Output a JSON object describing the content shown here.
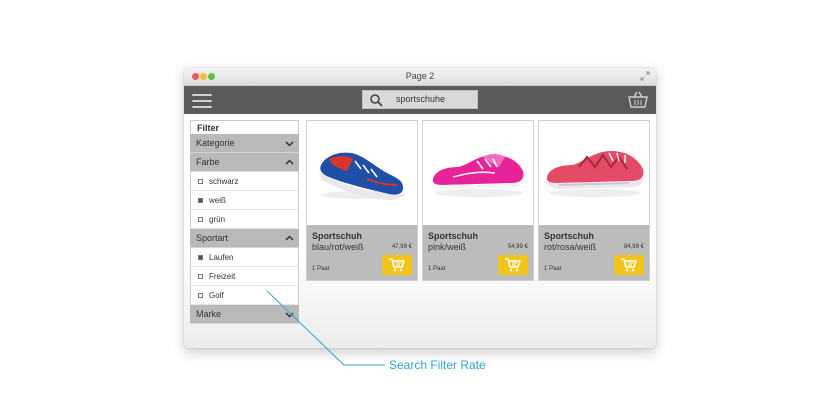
{
  "window": {
    "title": "Page 2"
  },
  "search": {
    "value": "sportschuhe"
  },
  "sidebar": {
    "heading": "Filter",
    "groups": [
      {
        "label": "Kategorie",
        "expanded": false,
        "options": []
      },
      {
        "label": "Farbe",
        "expanded": true,
        "options": [
          {
            "label": "schwarz",
            "checked": false
          },
          {
            "label": "weiß",
            "checked": true
          },
          {
            "label": "grün",
            "checked": false
          }
        ]
      },
      {
        "label": "Sportart",
        "expanded": true,
        "options": [
          {
            "label": "Laufen",
            "checked": true
          },
          {
            "label": "Freizeit",
            "checked": false
          },
          {
            "label": "Golf",
            "checked": false
          }
        ]
      },
      {
        "label": "Marke",
        "expanded": false,
        "options": []
      }
    ]
  },
  "products": [
    {
      "name": "Sportschuh",
      "color": "blau/rot/weiß",
      "price": "47,99 €",
      "qty": "1 Paar",
      "image": "shoe-blue-red",
      "shoe_colors": {
        "upper": "#1f4fa6",
        "accent": "#d8352f",
        "sole": "#e9e9e9"
      }
    },
    {
      "name": "Sportschuh",
      "color": "pink/weiß",
      "price": "54,99 €",
      "qty": "1 Paar",
      "image": "shoe-pink",
      "shoe_colors": {
        "upper": "#e8239a",
        "accent": "#f06fc0",
        "sole": "#f4f4f4"
      }
    },
    {
      "name": "Sportschuh",
      "color": "rot/rosa/weiß",
      "price": "84,99 €",
      "qty": "1 Paar",
      "image": "shoe-red-pink",
      "shoe_colors": {
        "upper": "#e44b67",
        "accent": "#a8283f",
        "sole": "#ece8ee"
      }
    }
  ],
  "annotation": {
    "label": "Search Filter Rate"
  },
  "colors": {
    "appbar": "#5b5b5b",
    "cart_button": "#f2c318",
    "annotation": "#2ea6c8"
  }
}
